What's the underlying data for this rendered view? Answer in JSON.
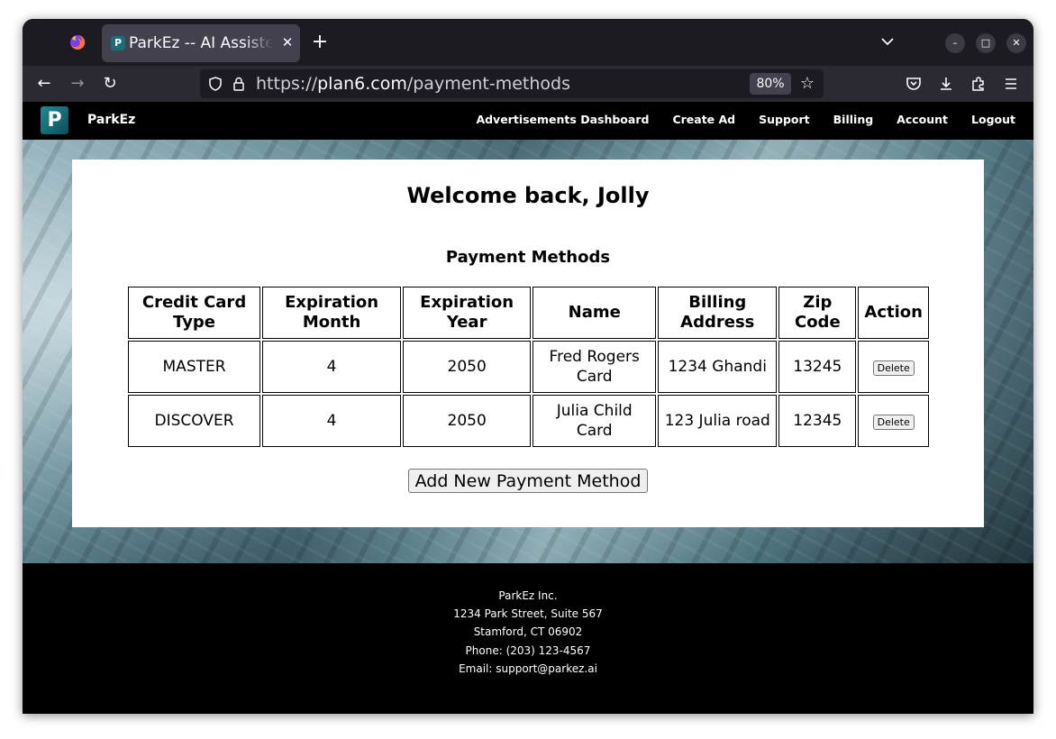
{
  "browser": {
    "tab_title": "ParkEz -- AI Assistec",
    "tab_favicon_letter": "P",
    "url_prefix": "https://",
    "url_host": "plan6.com",
    "url_path": "/payment-methods",
    "zoom": "80%"
  },
  "site": {
    "logo_letter": "P",
    "brand": "ParkEz",
    "nav": [
      "Advertisements Dashboard",
      "Create Ad",
      "Support",
      "Billing",
      "Account",
      "Logout"
    ]
  },
  "main": {
    "welcome": "Welcome back, Jolly",
    "section_title": "Payment Methods",
    "table": {
      "headers": [
        "Credit Card Type",
        "Expiration Month",
        "Expiration Year",
        "Name",
        "Billing Address",
        "Zip Code",
        "Action"
      ],
      "rows": [
        {
          "card_type": "MASTER",
          "exp_month": "4",
          "exp_year": "2050",
          "name": "Fred Rogers Card",
          "address": "1234 Ghandi",
          "zip": "13245",
          "action": "Delete"
        },
        {
          "card_type": "DISCOVER",
          "exp_month": "4",
          "exp_year": "2050",
          "name": "Julia Child Card",
          "address": "123 Julia road",
          "zip": "12345",
          "action": "Delete"
        }
      ]
    },
    "add_button": "Add New Payment Method"
  },
  "footer": {
    "lines": [
      "ParkEz Inc.",
      "1234 Park Street, Suite 567",
      "Stamford, CT 06902",
      "Phone: (203) 123-4567",
      "Email: support@parkez.ai"
    ]
  },
  "colors": {
    "tab_bg": "#42414d",
    "toolbar_bg": "#2b2a33",
    "site_nav_bg": "#000000",
    "logo_teal": "#1a6d7a"
  }
}
